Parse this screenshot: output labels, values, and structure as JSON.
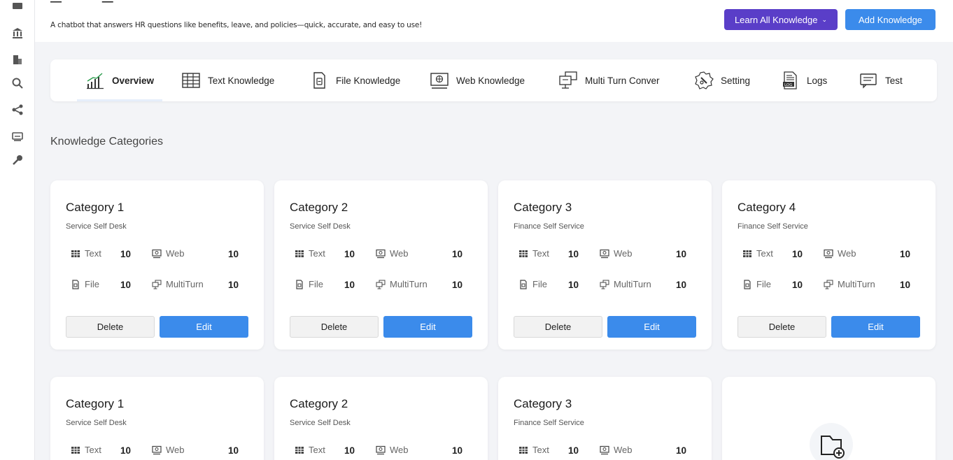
{
  "header": {
    "description": "A chatbot that answers HR questions like benefits, leave, and policies—quick, accurate, and easy to use!",
    "learn_button": "Learn All Knowledge",
    "add_button": "Add Knowledge"
  },
  "tabs": [
    {
      "label": "Overview",
      "icon": "chart-bars-icon"
    },
    {
      "label": "Text Knowledge",
      "icon": "table-grid-icon"
    },
    {
      "label": "File Knowledge",
      "icon": "file-icon"
    },
    {
      "label": "Web Knowledge",
      "icon": "monitor-globe-icon"
    },
    {
      "label": "Multi Turn Conver",
      "icon": "multi-monitor-icon"
    },
    {
      "label": "Setting",
      "icon": "gear-wrench-icon"
    },
    {
      "label": "Logs",
      "icon": "log-document-icon"
    },
    {
      "label": "Test",
      "icon": "chat-bubble-icon"
    }
  ],
  "section_title": "Knowledge Categories",
  "stat_labels": {
    "text": "Text",
    "web": "Web",
    "file": "File",
    "multiturn": "MultiTurn"
  },
  "card_buttons": {
    "delete": "Delete",
    "edit": "Edit"
  },
  "cards": [
    {
      "title": "Category 1",
      "subtitle": "Service Self Desk",
      "text": "10",
      "web": "10",
      "file": "10",
      "multiturn": "10"
    },
    {
      "title": "Category 2",
      "subtitle": "Service Self Desk",
      "text": "10",
      "web": "10",
      "file": "10",
      "multiturn": "10"
    },
    {
      "title": "Category 3",
      "subtitle": "Finance Self Service",
      "text": "10",
      "web": "10",
      "file": "10",
      "multiturn": "10"
    },
    {
      "title": "Category 4",
      "subtitle": "Finance Self Service",
      "text": "10",
      "web": "10",
      "file": "10",
      "multiturn": "10"
    },
    {
      "title": "Category 1",
      "subtitle": "Service Self Desk",
      "text": "10",
      "web": "10"
    },
    {
      "title": "Category 2",
      "subtitle": "Service Self Desk",
      "text": "10",
      "web": "10"
    },
    {
      "title": "Category 3",
      "subtitle": "Finance Self Service",
      "text": "10",
      "web": "10"
    }
  ],
  "colors": {
    "primary": "#3b8beb",
    "learn": "#5a3ec8",
    "background": "#f3f4f7"
  }
}
